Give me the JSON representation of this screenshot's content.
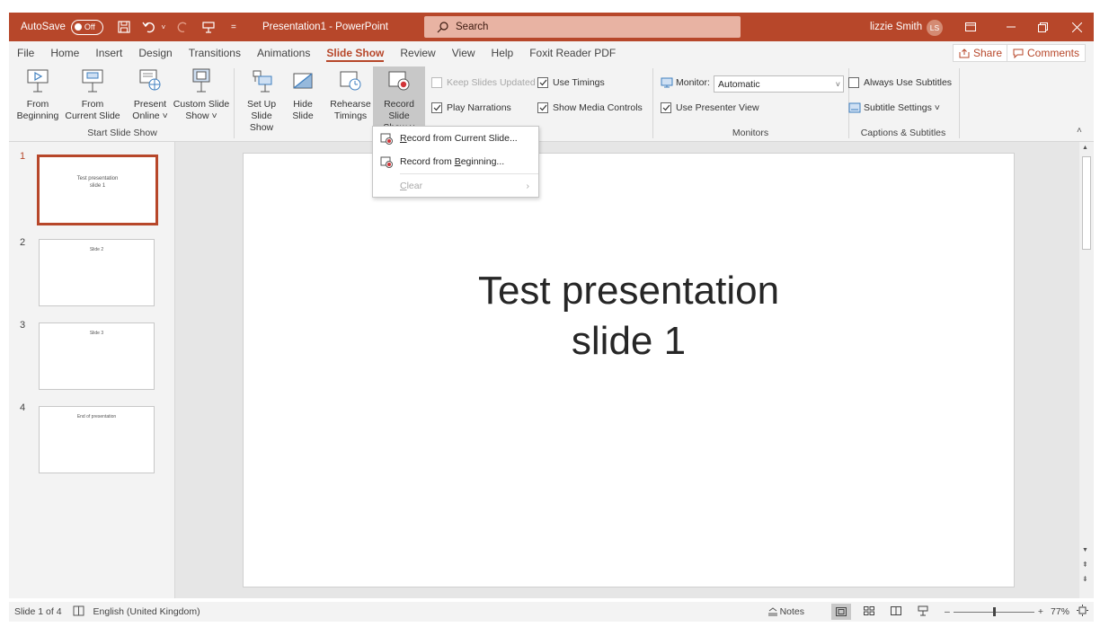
{
  "titlebar": {
    "autosave_label": "AutoSave",
    "autosave_state": "Off",
    "document_title": "Presentation1  -  PowerPoint",
    "search_placeholder": "Search",
    "user_name": "lizzie Smith",
    "user_initials": "LS",
    "accent_color": "#b7472a"
  },
  "tabs": [
    "File",
    "Home",
    "Insert",
    "Design",
    "Transitions",
    "Animations",
    "Slide Show",
    "Review",
    "View",
    "Help",
    "Foxit Reader PDF"
  ],
  "active_tab": "Slide Show",
  "share_label": "Share",
  "comments_label": "Comments",
  "ribbon": {
    "from_beginning": [
      "From",
      "Beginning"
    ],
    "from_current": [
      "From",
      "Current Slide"
    ],
    "present_online": [
      "Present",
      "Online ˅"
    ],
    "custom_show": [
      "Custom Slide",
      "Show ˅"
    ],
    "group_start": "Start Slide Show",
    "setup_show": [
      "Set Up",
      "Slide Show"
    ],
    "hide_slide": [
      "Hide",
      "Slide"
    ],
    "rehearse": [
      "Rehearse",
      "Timings"
    ],
    "record_show": [
      "Record Slide",
      "Show ˅"
    ],
    "keep_slides_updated": "Keep Slides Updated",
    "use_timings": "Use Timings",
    "play_narrations": "Play Narrations",
    "show_media_controls": "Show Media Controls",
    "monitor_label": "Monitor:",
    "monitor_value": "Automatic",
    "use_presenter_view": "Use Presenter View",
    "group_monitors": "Monitors",
    "always_use_subtitles": "Always Use Subtitles",
    "subtitle_settings": "Subtitle Settings ˅",
    "group_captions": "Captions & Subtitles"
  },
  "record_menu": {
    "item1_pre": "",
    "item1_key": "R",
    "item1_post": "ecord from Current Slide...",
    "item2_pre": "Record from ",
    "item2_key": "B",
    "item2_post": "eginning...",
    "item3_key": "C",
    "item3_post": "lear"
  },
  "slides": [
    {
      "num": "1",
      "text": "Test presentation\nslide 1"
    },
    {
      "num": "2",
      "text": "Slide 2"
    },
    {
      "num": "3",
      "text": "Slide 3"
    },
    {
      "num": "4",
      "text": "End of presentation"
    }
  ],
  "main_slide": {
    "line1": "Test presentation",
    "line2": "slide 1"
  },
  "statusbar": {
    "slide_of": "Slide 1 of 4",
    "language": "English (United Kingdom)",
    "notes_label": "Notes",
    "zoom_minus": "–",
    "zoom_plus": "+",
    "zoom": "77%"
  }
}
